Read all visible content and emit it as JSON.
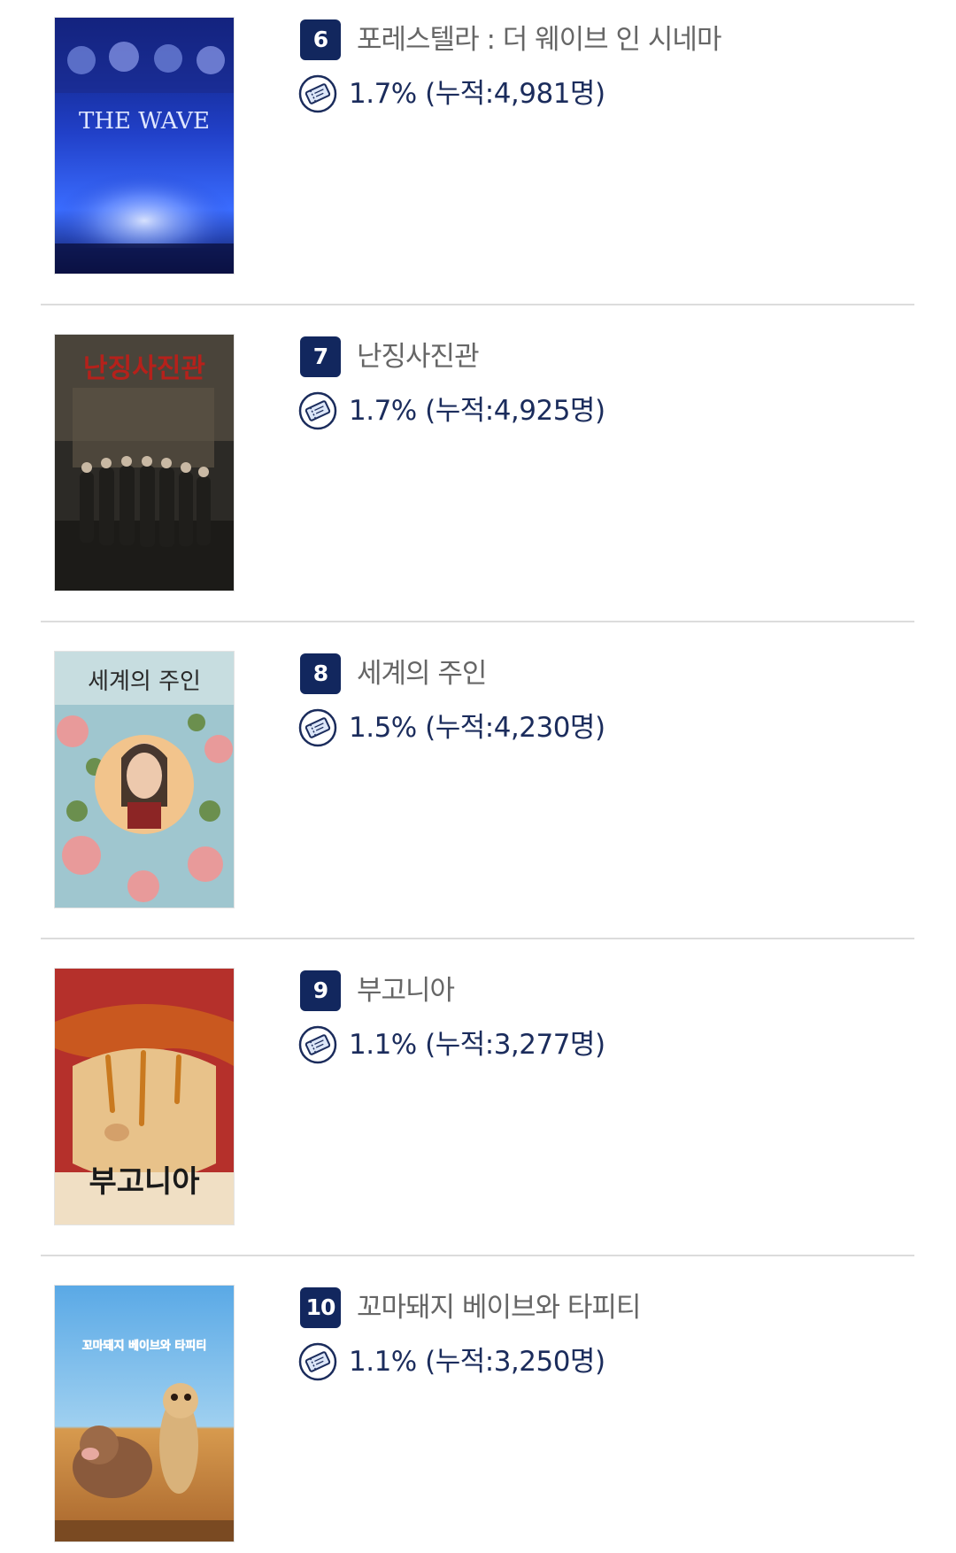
{
  "movies": [
    {
      "rank": "6",
      "title": "포레스텔라 : 더 웨이브 인 시네마",
      "stats": "1.7% (누적:4,981명)",
      "poster_text": "THE WAVE",
      "poster_icon": "concert-poster"
    },
    {
      "rank": "7",
      "title": "난징사진관",
      "stats": "1.7% (누적:4,925명)",
      "poster_text": "난징사진관",
      "poster_icon": "group-photo-poster"
    },
    {
      "rank": "8",
      "title": "세계의 주인",
      "stats": "1.5% (누적:4,230명)",
      "poster_text": "세계의 주인",
      "poster_icon": "flower-portrait-poster"
    },
    {
      "rank": "9",
      "title": "부고니아",
      "stats": "1.1% (누적:3,277명)",
      "poster_text": "부고니아",
      "poster_icon": "dripping-face-poster"
    },
    {
      "rank": "10",
      "title": "꼬마돼지 베이브와 타피티",
      "stats": "1.1% (누적:3,250명)",
      "poster_text": "꼬마돼지 베이브와 타피티",
      "poster_icon": "animation-poster"
    }
  ],
  "colors": {
    "badge": "#12275e",
    "stats_text": "#1b2c5c",
    "title_text": "#666666",
    "divider": "#dcdcdc"
  },
  "icons": {
    "ticket": "ticket-icon"
  }
}
